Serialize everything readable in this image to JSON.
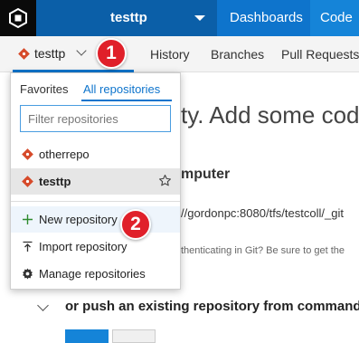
{
  "header": {
    "project_name": "testtp",
    "nav": [
      "Dashboards",
      "Code"
    ]
  },
  "subnav": {
    "repo_name": "testtp",
    "items": [
      "History",
      "Branches",
      "Pull Requests"
    ]
  },
  "background": {
    "heading": "ty. Add some code",
    "section": "mputer",
    "url": "//gordonpc:8080/tfs/testcoll/_git",
    "auth_note": "thenticating in Git? Be sure to get the",
    "push_heading": "or push an existing repository from command"
  },
  "dropdown": {
    "tabs": [
      "Favorites",
      "All repositories"
    ],
    "filter_placeholder": "Filter repositories",
    "repos": [
      "otherrepo",
      "testtp"
    ],
    "actions": [
      "New repository",
      "Import repository",
      "Manage repositories"
    ]
  },
  "badges": [
    "1",
    "2"
  ],
  "colors": {
    "brand_blue": "#0e74cc",
    "repo_icon": "#d64a2a",
    "badge_red": "#e0202a"
  }
}
